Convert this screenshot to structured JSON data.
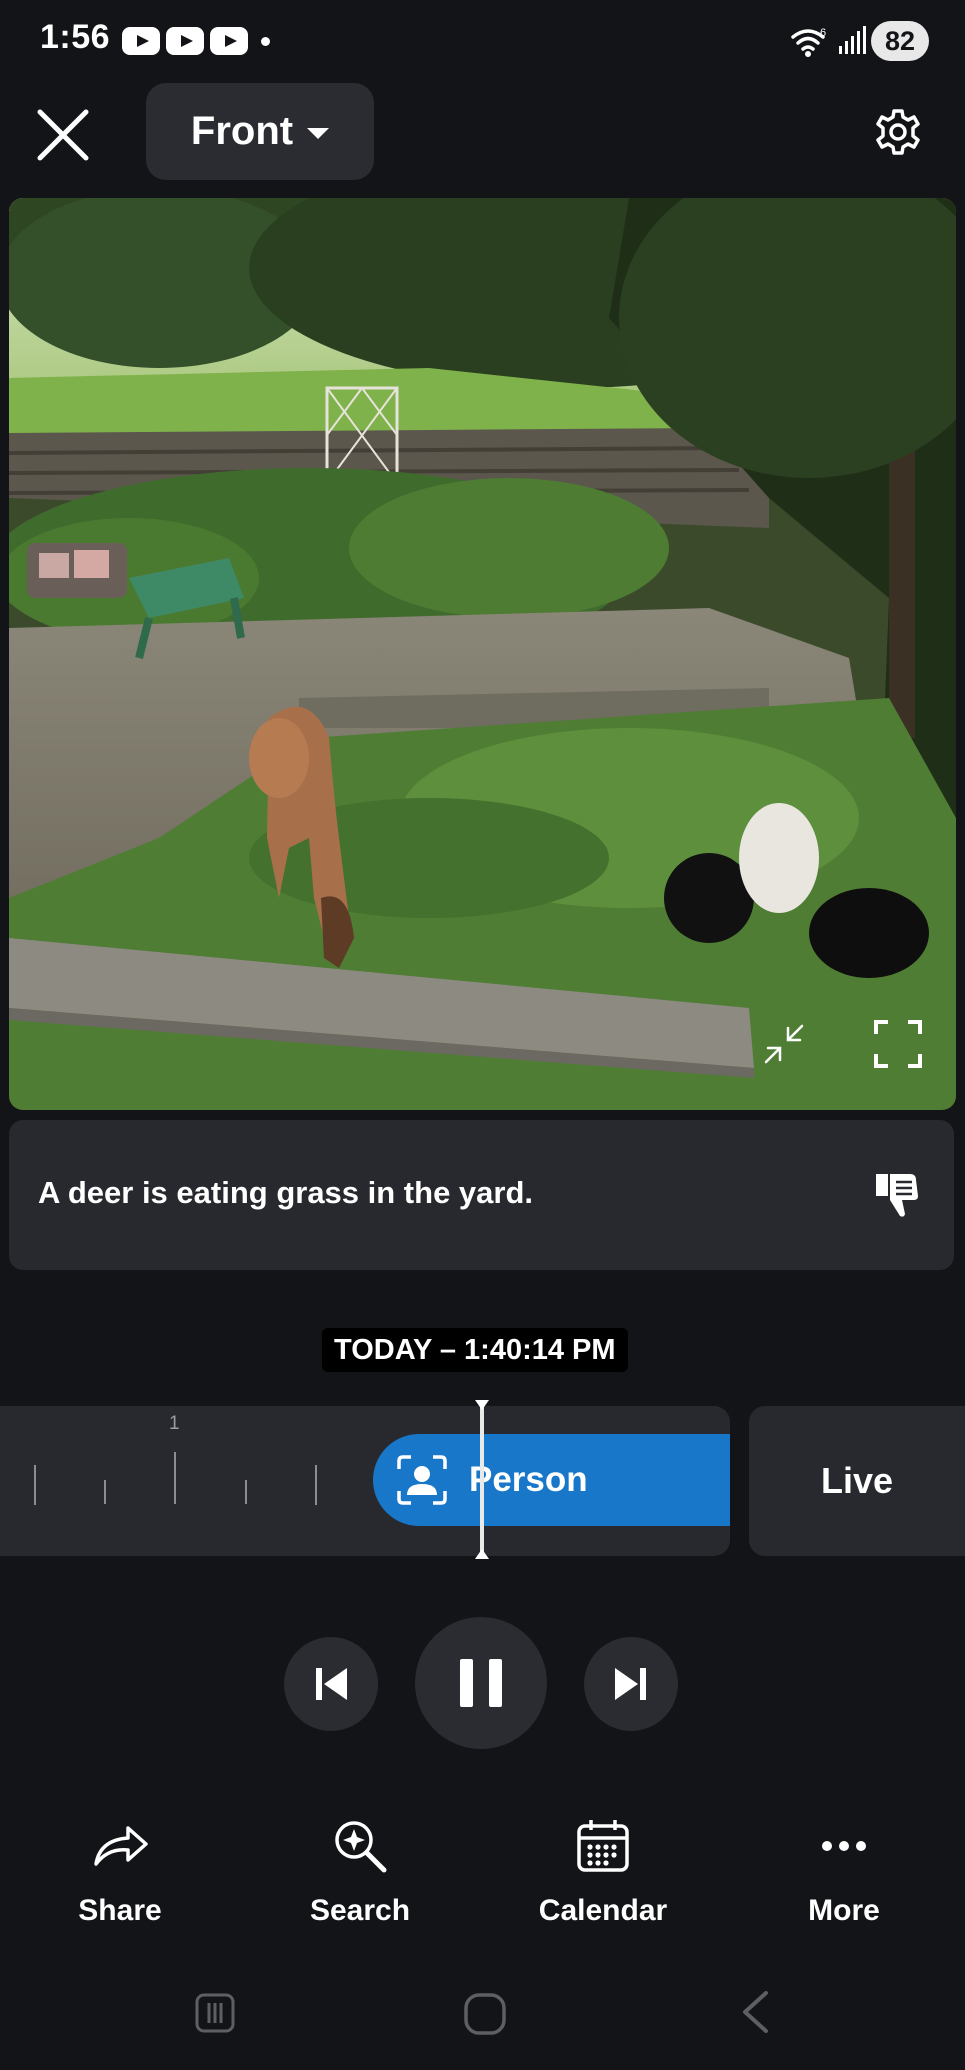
{
  "status_bar": {
    "time": "1:56",
    "battery": "82",
    "network": "6"
  },
  "header": {
    "camera_name": "Front"
  },
  "caption": {
    "text": "A deer is eating grass in the yard."
  },
  "timeline": {
    "timestamp": "TODAY – 1:40:14 PM",
    "tick_label": "1",
    "event_label": "Person",
    "live_label": "Live"
  },
  "actions": [
    {
      "label": "Share"
    },
    {
      "label": "Search"
    },
    {
      "label": "Calendar"
    },
    {
      "label": "More"
    }
  ],
  "icons": {
    "close": "close-icon",
    "gear": "gear-icon",
    "exit_fullscreen": "collapse-icon",
    "fullscreen": "fullscreen-icon",
    "feedback": "thumbs-down-feedback-icon",
    "person": "person-icon",
    "previous": "skip-previous-icon",
    "pause": "pause-icon",
    "next": "skip-next-icon",
    "share": "share-arrow-icon",
    "search": "search-sparkle-icon",
    "calendar": "calendar-icon",
    "more": "more-dots-icon"
  },
  "colors": {
    "background": "#131417",
    "panel": "#27292e",
    "accent": "#1877c9"
  }
}
